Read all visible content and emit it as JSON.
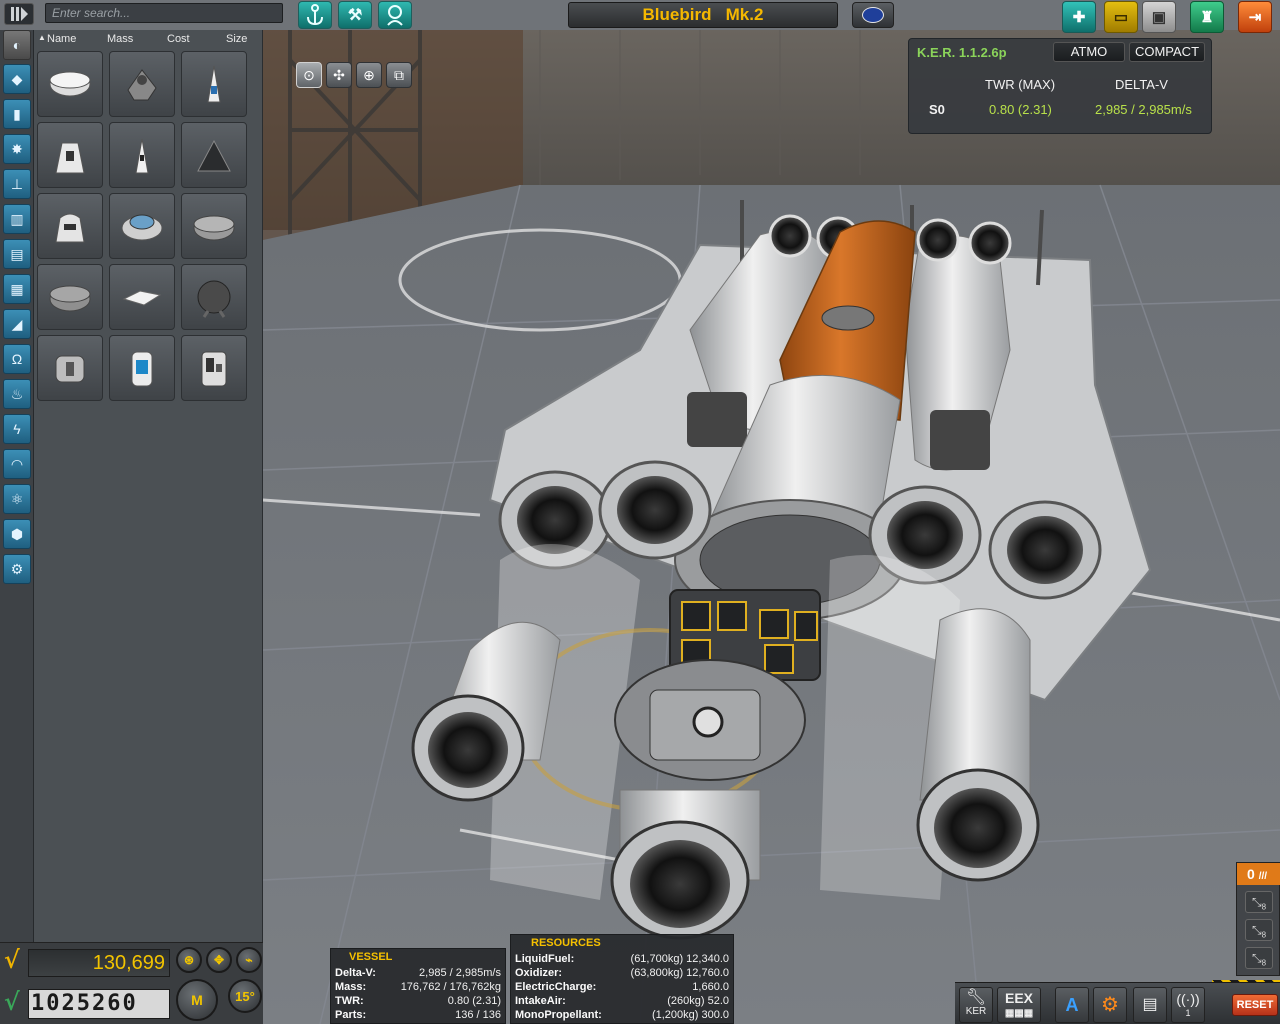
{
  "search": {
    "placeholder": "Enter search..."
  },
  "vessel_name": "Bluebird   Mk.2",
  "parts_header": {
    "name": "Name",
    "mass": "Mass",
    "cost": "Cost",
    "size": "Size"
  },
  "parts": [
    "part-1",
    "part-2",
    "part-3",
    "part-4",
    "part-5",
    "part-6",
    "part-7",
    "part-8",
    "part-9",
    "part-10",
    "part-11",
    "part-12",
    "part-13",
    "part-14",
    "part-15"
  ],
  "funds": "130,699",
  "science": "1025260",
  "mode_label": "M",
  "angle_snap": "15°",
  "ker": {
    "title": "K.E.R. 1.1.2.6p",
    "atmo": "ATMO",
    "compact": "COMPACT",
    "headers": {
      "twr": "TWR (MAX)",
      "dv": "DELTA-V"
    },
    "stage": "S0",
    "twr": "0.80 (2.31)",
    "dv": "2,985 / 2,985m/s"
  },
  "vessel_panel": {
    "title": "VESSEL",
    "rows": [
      {
        "k": "Delta-V:",
        "v": "2,985 / 2,985m/s"
      },
      {
        "k": "Mass:",
        "v": "176,762 / 176,762kg"
      },
      {
        "k": "TWR:",
        "v": "0.80 (2.31)"
      },
      {
        "k": "Parts:",
        "v": "136 / 136"
      }
    ]
  },
  "resources_panel": {
    "title": "RESOURCES",
    "rows": [
      {
        "k": "LiquidFuel:",
        "v": "(61,700kg) 12,340.0"
      },
      {
        "k": "Oxidizer:",
        "v": "(63,800kg) 12,760.0"
      },
      {
        "k": "ElectricCharge:",
        "v": "1,660.0"
      },
      {
        "k": "IntakeAir:",
        "v": "(260kg) 52.0"
      },
      {
        "k": "MonoPropellant:",
        "v": "(1,200kg) 300.0"
      }
    ]
  },
  "stage_count": "0",
  "stage_items": [
    "8",
    "8",
    "8"
  ],
  "toolbar": {
    "ker_label": "KER",
    "eex_label": "EEX",
    "reset_label": "RESET",
    "comms_count": "1"
  },
  "colors": {
    "accent": "#f5b800",
    "ker_green": "#8bd45a",
    "teal": "#2fb8b0",
    "orange_tank": "#c8661e"
  }
}
